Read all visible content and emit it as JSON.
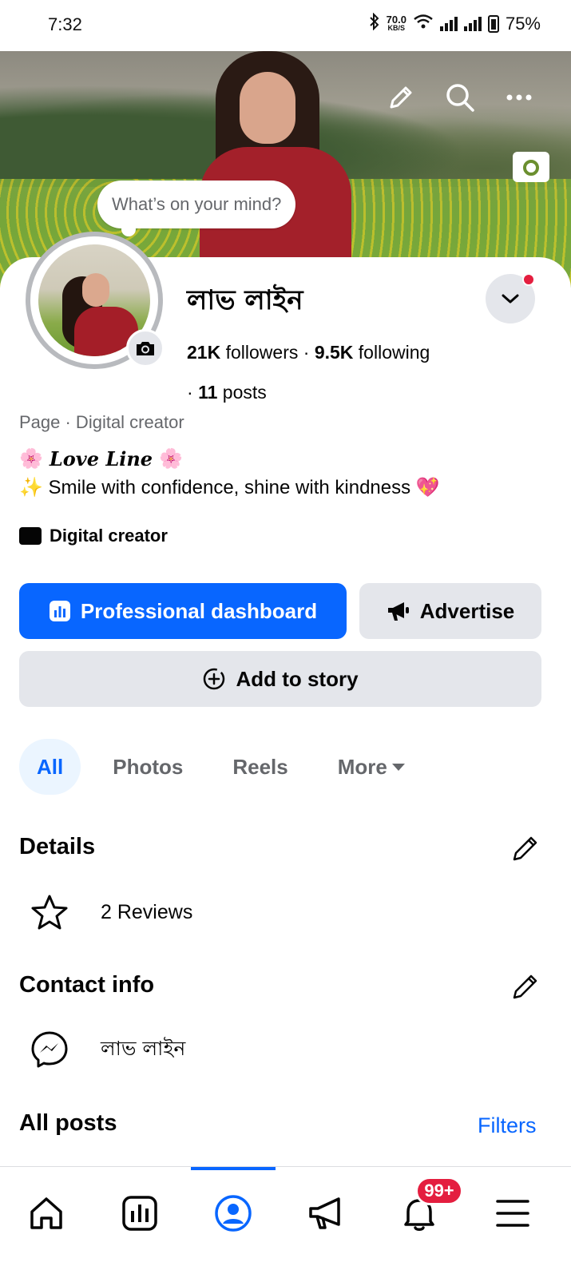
{
  "status_bar": {
    "time": "7:32",
    "net_speed": "70.0",
    "net_unit": "KB/S",
    "battery": "75%"
  },
  "cover": {
    "prompt": "What’s on your mind?"
  },
  "profile": {
    "name": "লাভ লাইন",
    "followers_count": "21K",
    "followers_label": "followers",
    "following_count": "9.5K",
    "following_label": "following",
    "posts_count": "11",
    "posts_label": "posts",
    "category": "Page · Digital creator",
    "bio_title": "Love Line",
    "bio_line": "✨ Smile with confidence, shine with kindness 💖",
    "creator_label": "Digital creator"
  },
  "actions": {
    "dashboard_label": "Professional dashboard",
    "advertise_label": "Advertise",
    "story_label": "Add to story"
  },
  "tabs": [
    {
      "label": "All",
      "active": true
    },
    {
      "label": "Photos",
      "active": false
    },
    {
      "label": "Reels",
      "active": false
    },
    {
      "label": "More",
      "active": false
    }
  ],
  "details": {
    "title": "Details",
    "reviews": "2 Reviews"
  },
  "contact": {
    "title": "Contact info",
    "messenger": "লাভ লাইন"
  },
  "posts": {
    "title": "All posts",
    "filters_label": "Filters"
  },
  "bottom_nav": {
    "notifications_badge": "99+",
    "active_item": "profile"
  },
  "colors": {
    "accent": "#0866ff",
    "badge": "#e41e3f",
    "secondary_button": "#e4e6eb"
  }
}
